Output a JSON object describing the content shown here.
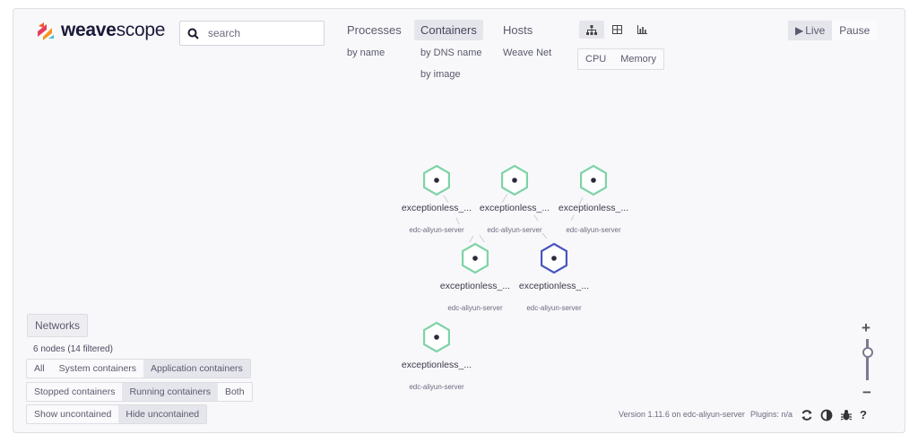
{
  "logo": {
    "brand_bold": "weave",
    "brand_light": "scope"
  },
  "search": {
    "placeholder": "search"
  },
  "nav": {
    "processes": {
      "label": "Processes",
      "subs": [
        "by name"
      ]
    },
    "containers": {
      "label": "Containers",
      "subs": [
        "by DNS name",
        "by image"
      ]
    },
    "hosts": {
      "label": "Hosts",
      "subs": [
        "Weave Net"
      ]
    }
  },
  "view_modes": [
    "graph-icon",
    "table-icon",
    "resources-icon"
  ],
  "metrics": [
    "CPU",
    "Memory"
  ],
  "live": {
    "live_label": "Live",
    "pause_label": "Pause"
  },
  "nodes": [
    {
      "label": "exceptionless_...",
      "sublabel": "edc-aliyun-server",
      "color": "#7ed3a6"
    },
    {
      "label": "exceptionless_...",
      "sublabel": "edc-aliyun-server",
      "color": "#7ed3a6"
    },
    {
      "label": "exceptionless_...",
      "sublabel": "edc-aliyun-server",
      "color": "#7ed3a6"
    },
    {
      "label": "exceptionless_...",
      "sublabel": "edc-aliyun-server",
      "color": "#7ed3a6"
    },
    {
      "label": "exceptionless_...",
      "sublabel": "edc-aliyun-server",
      "color": "#4a55c0"
    },
    {
      "label": "exceptionless_...",
      "sublabel": "edc-aliyun-server",
      "color": "#7ed3a6"
    }
  ],
  "sidebar": {
    "networks": "Networks",
    "node_count": "6 nodes (14 filtered)",
    "filter_type": [
      "All",
      "System containers",
      "Application containers"
    ],
    "filter_state": [
      "Stopped containers",
      "Running containers",
      "Both"
    ],
    "filter_uncontained": [
      "Show uncontained",
      "Hide uncontained"
    ]
  },
  "zoom": {
    "plus": "+",
    "minus": "−"
  },
  "footer": {
    "version": "Version 1.11.6 on edc-aliyun-server",
    "plugins": "Plugins: n/a"
  },
  "footer_icons": [
    "refresh-icon",
    "contrast-icon",
    "bug-icon",
    "help-icon"
  ],
  "colors": {
    "accent": "#7ed3a6",
    "selected": "#4a55c0",
    "text": "#5a5a6e"
  }
}
